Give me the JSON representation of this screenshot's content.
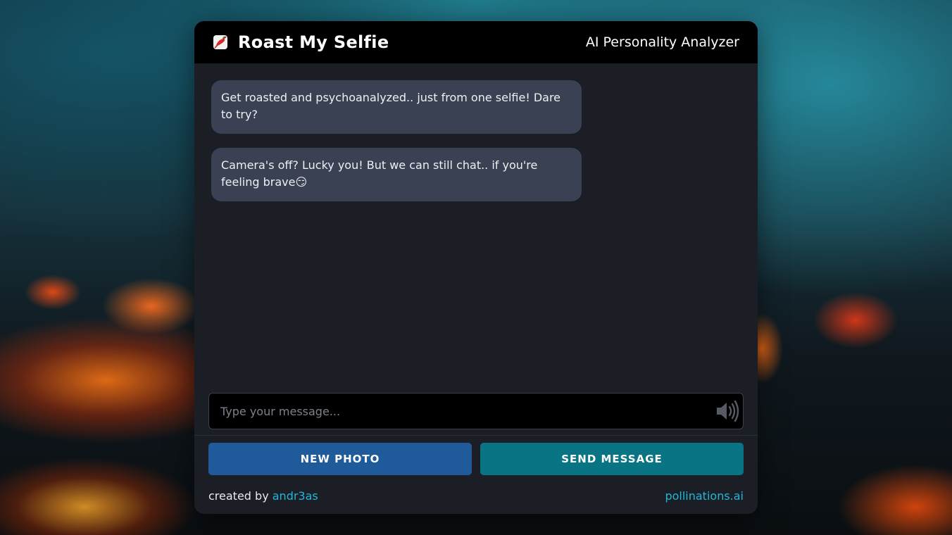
{
  "header": {
    "icon": "chili-pepper-icon",
    "title": "Roast My Selfie",
    "subtitle": "AI Personality Analyzer"
  },
  "messages": [
    {
      "text": "Get roasted and psychoanalyzed.. just from one selfie! Dare to try?"
    },
    {
      "text": "Camera's off? Lucky you! But we can still chat.. if you're feeling brave😏"
    }
  ],
  "input": {
    "placeholder": "Type your message...",
    "value": "",
    "icon": "speaker-icon"
  },
  "buttons": {
    "new_photo": "NEW PHOTO",
    "send_message": "SEND MESSAGE"
  },
  "footer": {
    "created_by_label": "created by",
    "author": "andr3as",
    "site": "pollinations.ai"
  },
  "colors": {
    "header_bg": "#000000",
    "panel_bg": "#1c1e26",
    "bubble_bg": "#394152",
    "new_photo_button": "#1f5a9a",
    "send_button": "#087484",
    "link": "#22b7d6"
  }
}
